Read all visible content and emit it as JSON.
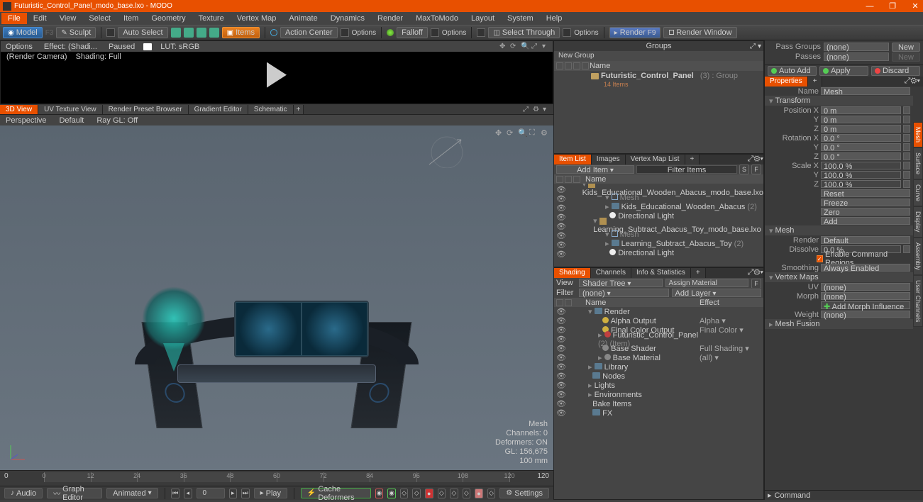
{
  "title": "Futuristic_Control_Panel_modo_base.lxo - MODO",
  "menus": [
    "File",
    "Edit",
    "View",
    "Select",
    "Item",
    "Geometry",
    "Texture",
    "Vertex Map",
    "Animate",
    "Dynamics",
    "Render",
    "MaxToModo",
    "Layout",
    "System",
    "Help"
  ],
  "toolbar": {
    "model": "Model",
    "sculpt": "Sculpt",
    "autoselect": "Auto Select",
    "items": "Items",
    "actioncenter": "Action Center",
    "options": "Options",
    "falloff": "Falloff",
    "selectthrough": "Select Through",
    "render": "Render",
    "renderwindow": "Render Window"
  },
  "render_preview": {
    "options": "Options",
    "effect": "Effect: (Shadi...",
    "paused": "Paused",
    "lut": "LUT: sRGB",
    "camera": "(Render Camera)",
    "shading": "Shading: Full"
  },
  "view_tabs": [
    "3D View",
    "UV Texture View",
    "Render Preset Browser",
    "Gradient Editor",
    "Schematic"
  ],
  "view_ctrl": {
    "mode": "Perspective",
    "def": "Default",
    "raygl": "Ray GL: Off"
  },
  "vp_stats": {
    "type": "Mesh",
    "channels": "Channels: 0",
    "deformers": "Deformers: ON",
    "gl": "GL: 156,675",
    "scale": "100 mm"
  },
  "timeline": {
    "start": "0",
    "end": "120",
    "ticks": [
      0,
      12,
      24,
      36,
      48,
      60,
      72,
      84,
      96,
      108,
      120
    ]
  },
  "bottombar": {
    "audio": "Audio",
    "graph": "Graph Editor",
    "animated": "Animated",
    "frame": "0",
    "play": "Play",
    "cache": "Cache Deformers",
    "settings": "Settings"
  },
  "groups": {
    "title": "Groups",
    "new_group": "New Group",
    "col_name": "Name",
    "root": "Futuristic_Control_Panel",
    "root_count": "(3)",
    "root_type": ": Group",
    "root_sub": "14 Items"
  },
  "itemlist": {
    "tabs": [
      "Item List",
      "Images",
      "Vertex Map List"
    ],
    "add": "Add Item",
    "filter_ph": "Filter Items",
    "col_name": "Name",
    "rows": [
      {
        "d": 1,
        "tw": "▾",
        "ico": "disk",
        "n": "Kids_Educational_Wooden_Abacus_modo_base.lxo"
      },
      {
        "d": 2,
        "tw": "▾",
        "ico": "mesh",
        "n": "Mesh",
        "dim": true
      },
      {
        "d": 2,
        "tw": "▸",
        "ico": "fldr",
        "n": "Kids_Educational_Wooden_Abacus",
        "cnt": "(2)"
      },
      {
        "d": 2,
        "tw": "",
        "ico": "light",
        "n": "Directional Light"
      },
      {
        "d": 1,
        "tw": "▾",
        "ico": "disk",
        "n": "Learning_Subtract_Abacus_Toy_modo_base.lxo"
      },
      {
        "d": 2,
        "tw": "▾",
        "ico": "mesh",
        "n": "Mesh",
        "dim": true
      },
      {
        "d": 2,
        "tw": "▸",
        "ico": "fldr",
        "n": "Learning_Subtract_Abacus_Toy",
        "cnt": "(2)"
      },
      {
        "d": 2,
        "tw": "",
        "ico": "light",
        "n": "Directional Light"
      }
    ]
  },
  "shading": {
    "tabs": [
      "Shading",
      "Channels",
      "Info & Statistics"
    ],
    "view": "View",
    "shadertree": "Shader Tree",
    "assign": "Assign Material",
    "filter": "Filter",
    "none": "(none)",
    "addlayer": "Add Layer",
    "col_name": "Name",
    "col_effect": "Effect",
    "rows": [
      {
        "d": 1,
        "tw": "▾",
        "ico": "fldr",
        "n": "Render",
        "ef": ""
      },
      {
        "d": 2,
        "ico": "y",
        "n": "Alpha Output",
        "ef": "Alpha",
        "dd": true
      },
      {
        "d": 2,
        "ico": "y",
        "n": "Final Color Output",
        "ef": "Final Color",
        "dd": true
      },
      {
        "d": 2,
        "tw": "▸",
        "ico": "r",
        "n": "Futuristic_Control_Panel",
        "cnt": "(2) (Item)"
      },
      {
        "d": 2,
        "ico": "g",
        "n": "Base Shader",
        "ef": "Full Shading",
        "dd": true
      },
      {
        "d": 2,
        "tw": "▸",
        "ico": "g",
        "n": "Base Material",
        "ef": "(all)",
        "dd": true
      },
      {
        "d": 1,
        "tw": "▸",
        "ico": "fldr",
        "n": "Library"
      },
      {
        "d": 1,
        "tw": "",
        "ico": "fldr",
        "n": "Nodes"
      },
      {
        "d": 1,
        "tw": "▸",
        "n": "Lights"
      },
      {
        "d": 1,
        "tw": "▸",
        "n": "Environments"
      },
      {
        "d": 1,
        "n": "Bake Items"
      },
      {
        "d": 1,
        "ico": "fldr",
        "n": "FX"
      }
    ]
  },
  "props": {
    "passgroups": "Pass Groups",
    "passes": "Passes",
    "none": "(none)",
    "new": "New",
    "autoadd": "Auto Add",
    "apply": "Apply",
    "discard": "Discard",
    "properties_tab": "Properties",
    "name_label": "Name",
    "name_value": "Mesh",
    "transform": "Transform",
    "posx": "Position X",
    "pos": [
      "0 m",
      "0 m",
      "0 m"
    ],
    "rotx": "Rotation X",
    "rot": [
      "0.0 °",
      "0.0 °",
      "0.0 °"
    ],
    "sclx": "Scale X",
    "scl": [
      "100.0 %",
      "100.0 %",
      "100.0 %"
    ],
    "y": "Y",
    "z": "Z",
    "reset": "Reset",
    "freeze": "Freeze",
    "zero": "Zero",
    "add": "Add",
    "mesh": "Mesh",
    "render": "Render",
    "default": "Default",
    "dissolve": "Dissolve",
    "dissolve_v": "0.0 %",
    "ecr": "Enable Command Regions",
    "smoothing": "Smoothing",
    "always": "Always Enabled",
    "vertexmaps": "Vertex Maps",
    "uv": "UV",
    "morph": "Morph",
    "weight": "Weight",
    "addmorph": "Add Morph Influence",
    "meshfusion": "Mesh Fusion",
    "side_tabs": [
      "Mesh",
      "Surface",
      "Curve",
      "Display",
      "Assembly",
      "User Channels"
    ]
  },
  "command": "Command"
}
